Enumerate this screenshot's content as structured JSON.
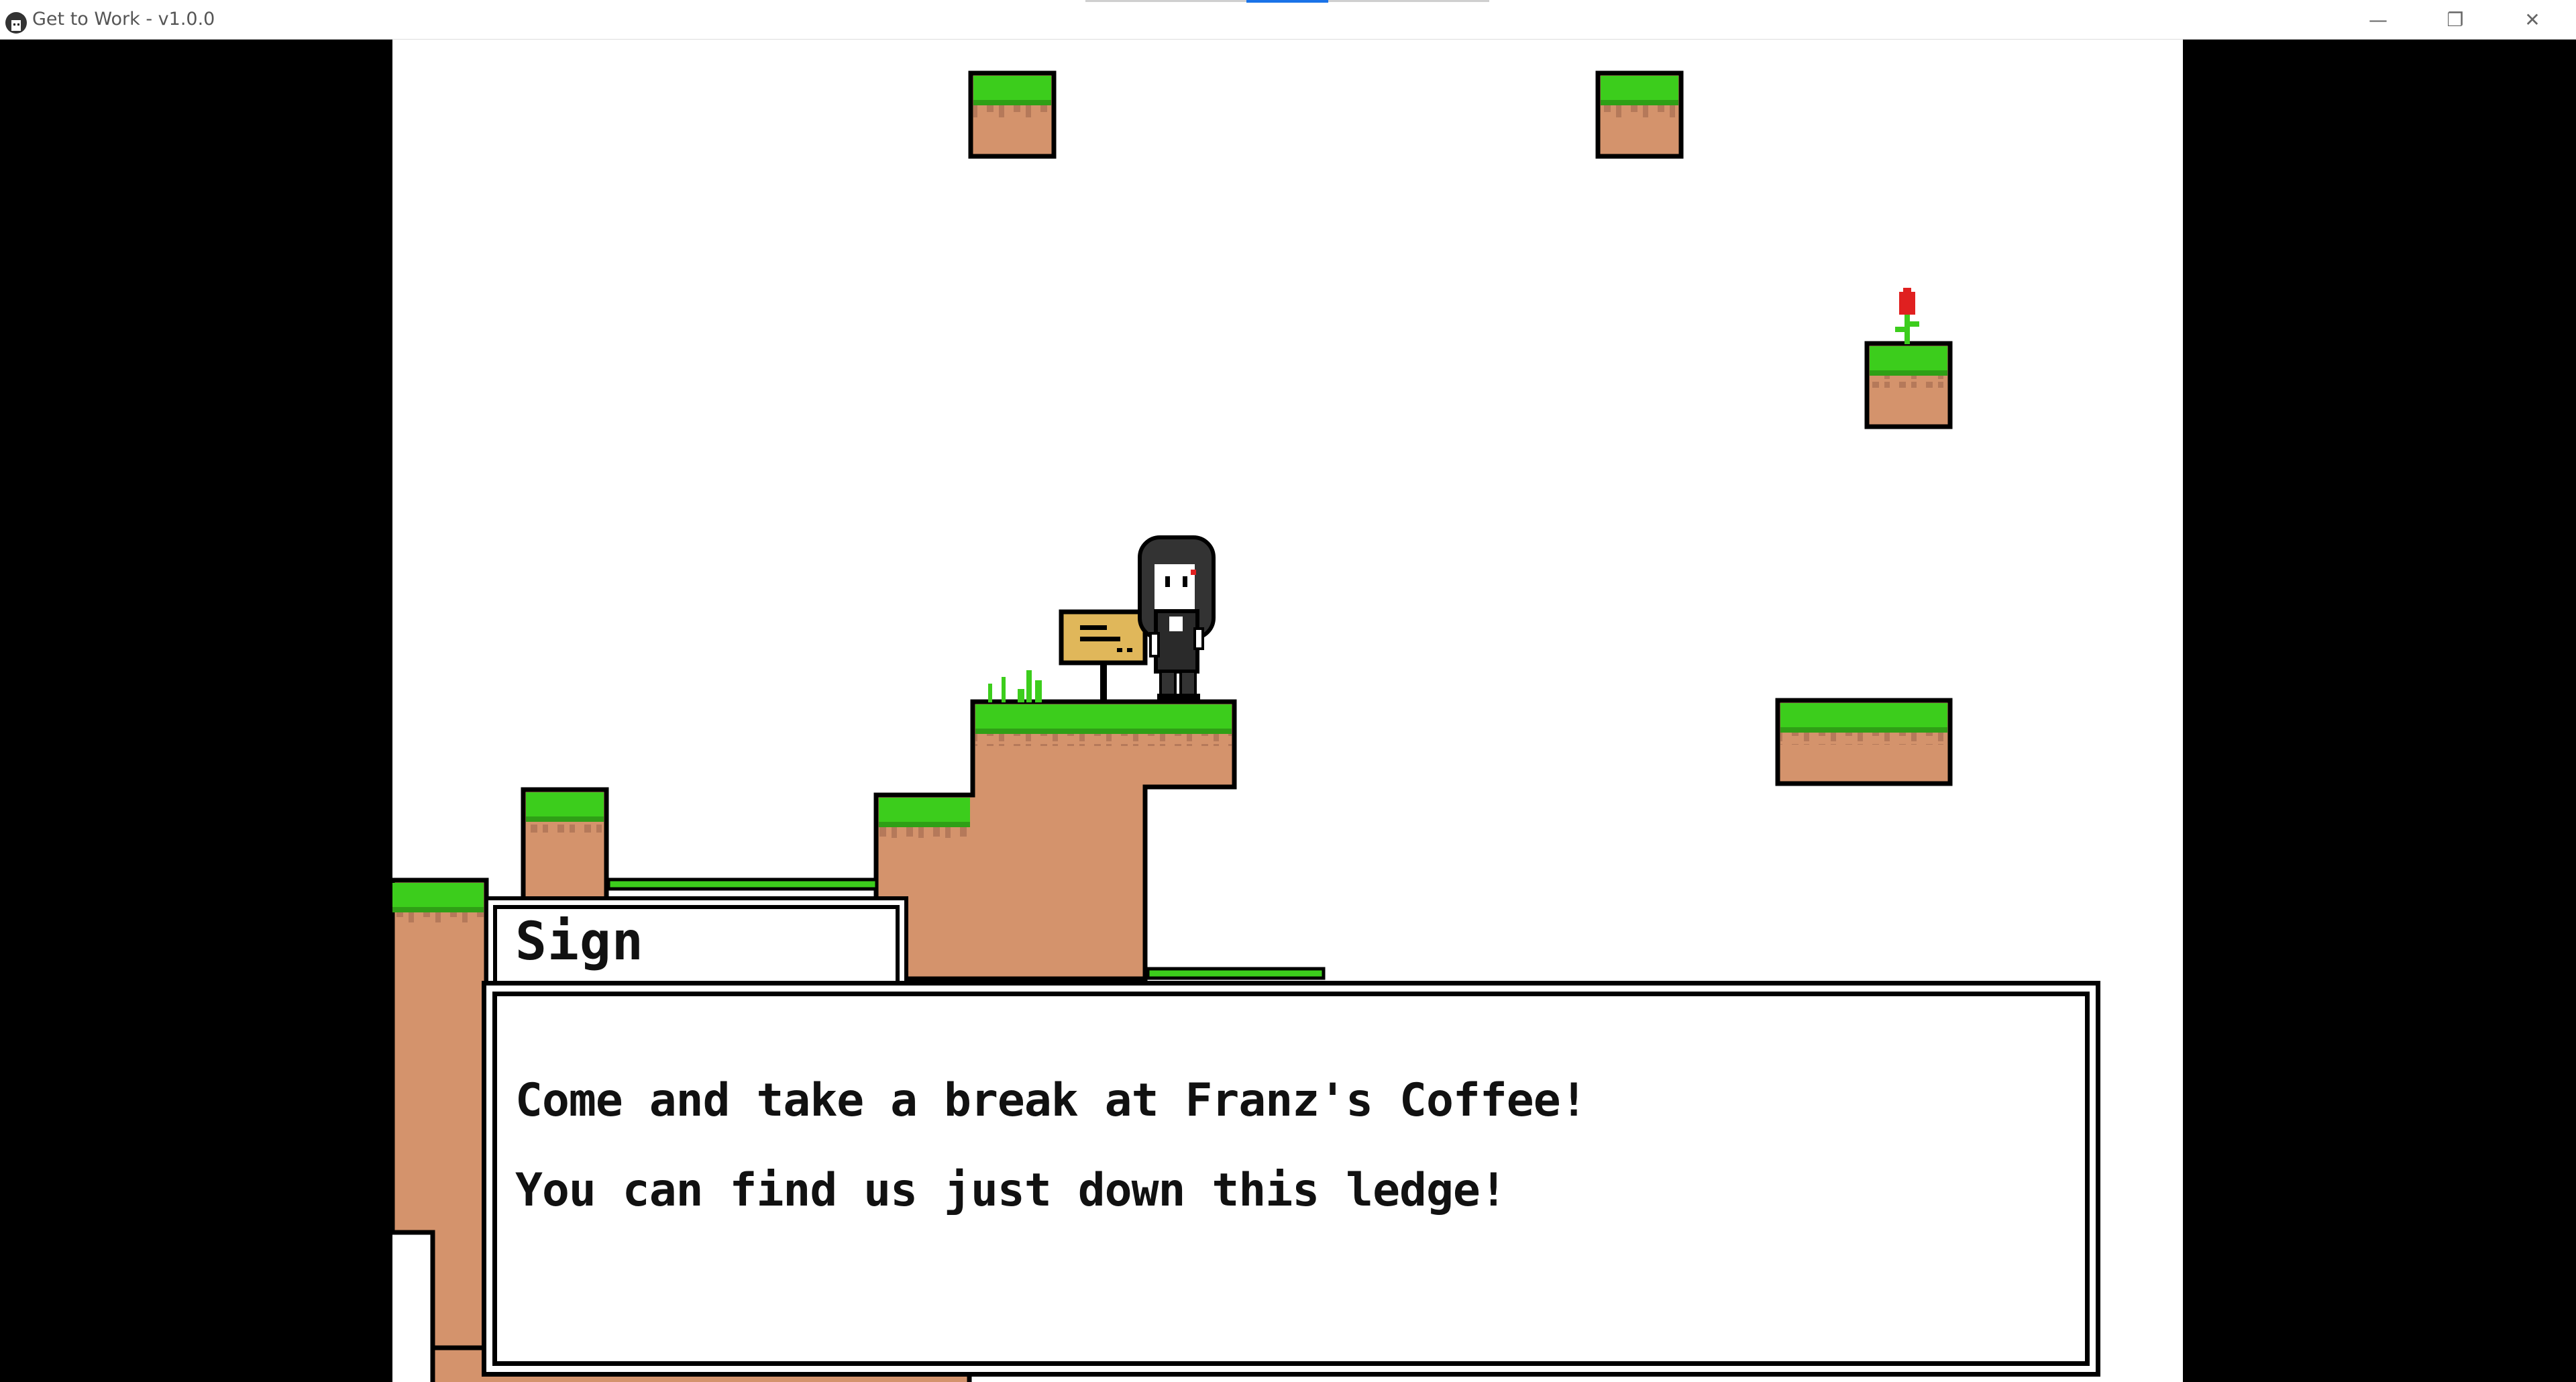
{
  "window": {
    "title": "Get to Work - v1.0.0",
    "icon": "app-avatar-icon",
    "minimize_glyph": "—",
    "restore_glyph": "❐",
    "close_glyph": "✕"
  },
  "dialog": {
    "speaker": "Sign",
    "lines": [
      "Come and take a break at Franz's Coffee!",
      "You can find us just down this ledge!"
    ]
  },
  "colors": {
    "grass": "#3ccd1c",
    "grass_dark": "#2f9f16",
    "dirt": "#d4936c",
    "dirt_dark": "#b5795a",
    "sign": "#e0b75a",
    "flower": "#e02020",
    "outline": "#000000"
  },
  "scene": {
    "objects": [
      "floating-block",
      "floating-block",
      "flower-block",
      "wide-platform",
      "main-cliff",
      "small-pillar",
      "left-ledge",
      "wooden-sign",
      "player-character",
      "grass-tuft",
      "flower"
    ]
  }
}
